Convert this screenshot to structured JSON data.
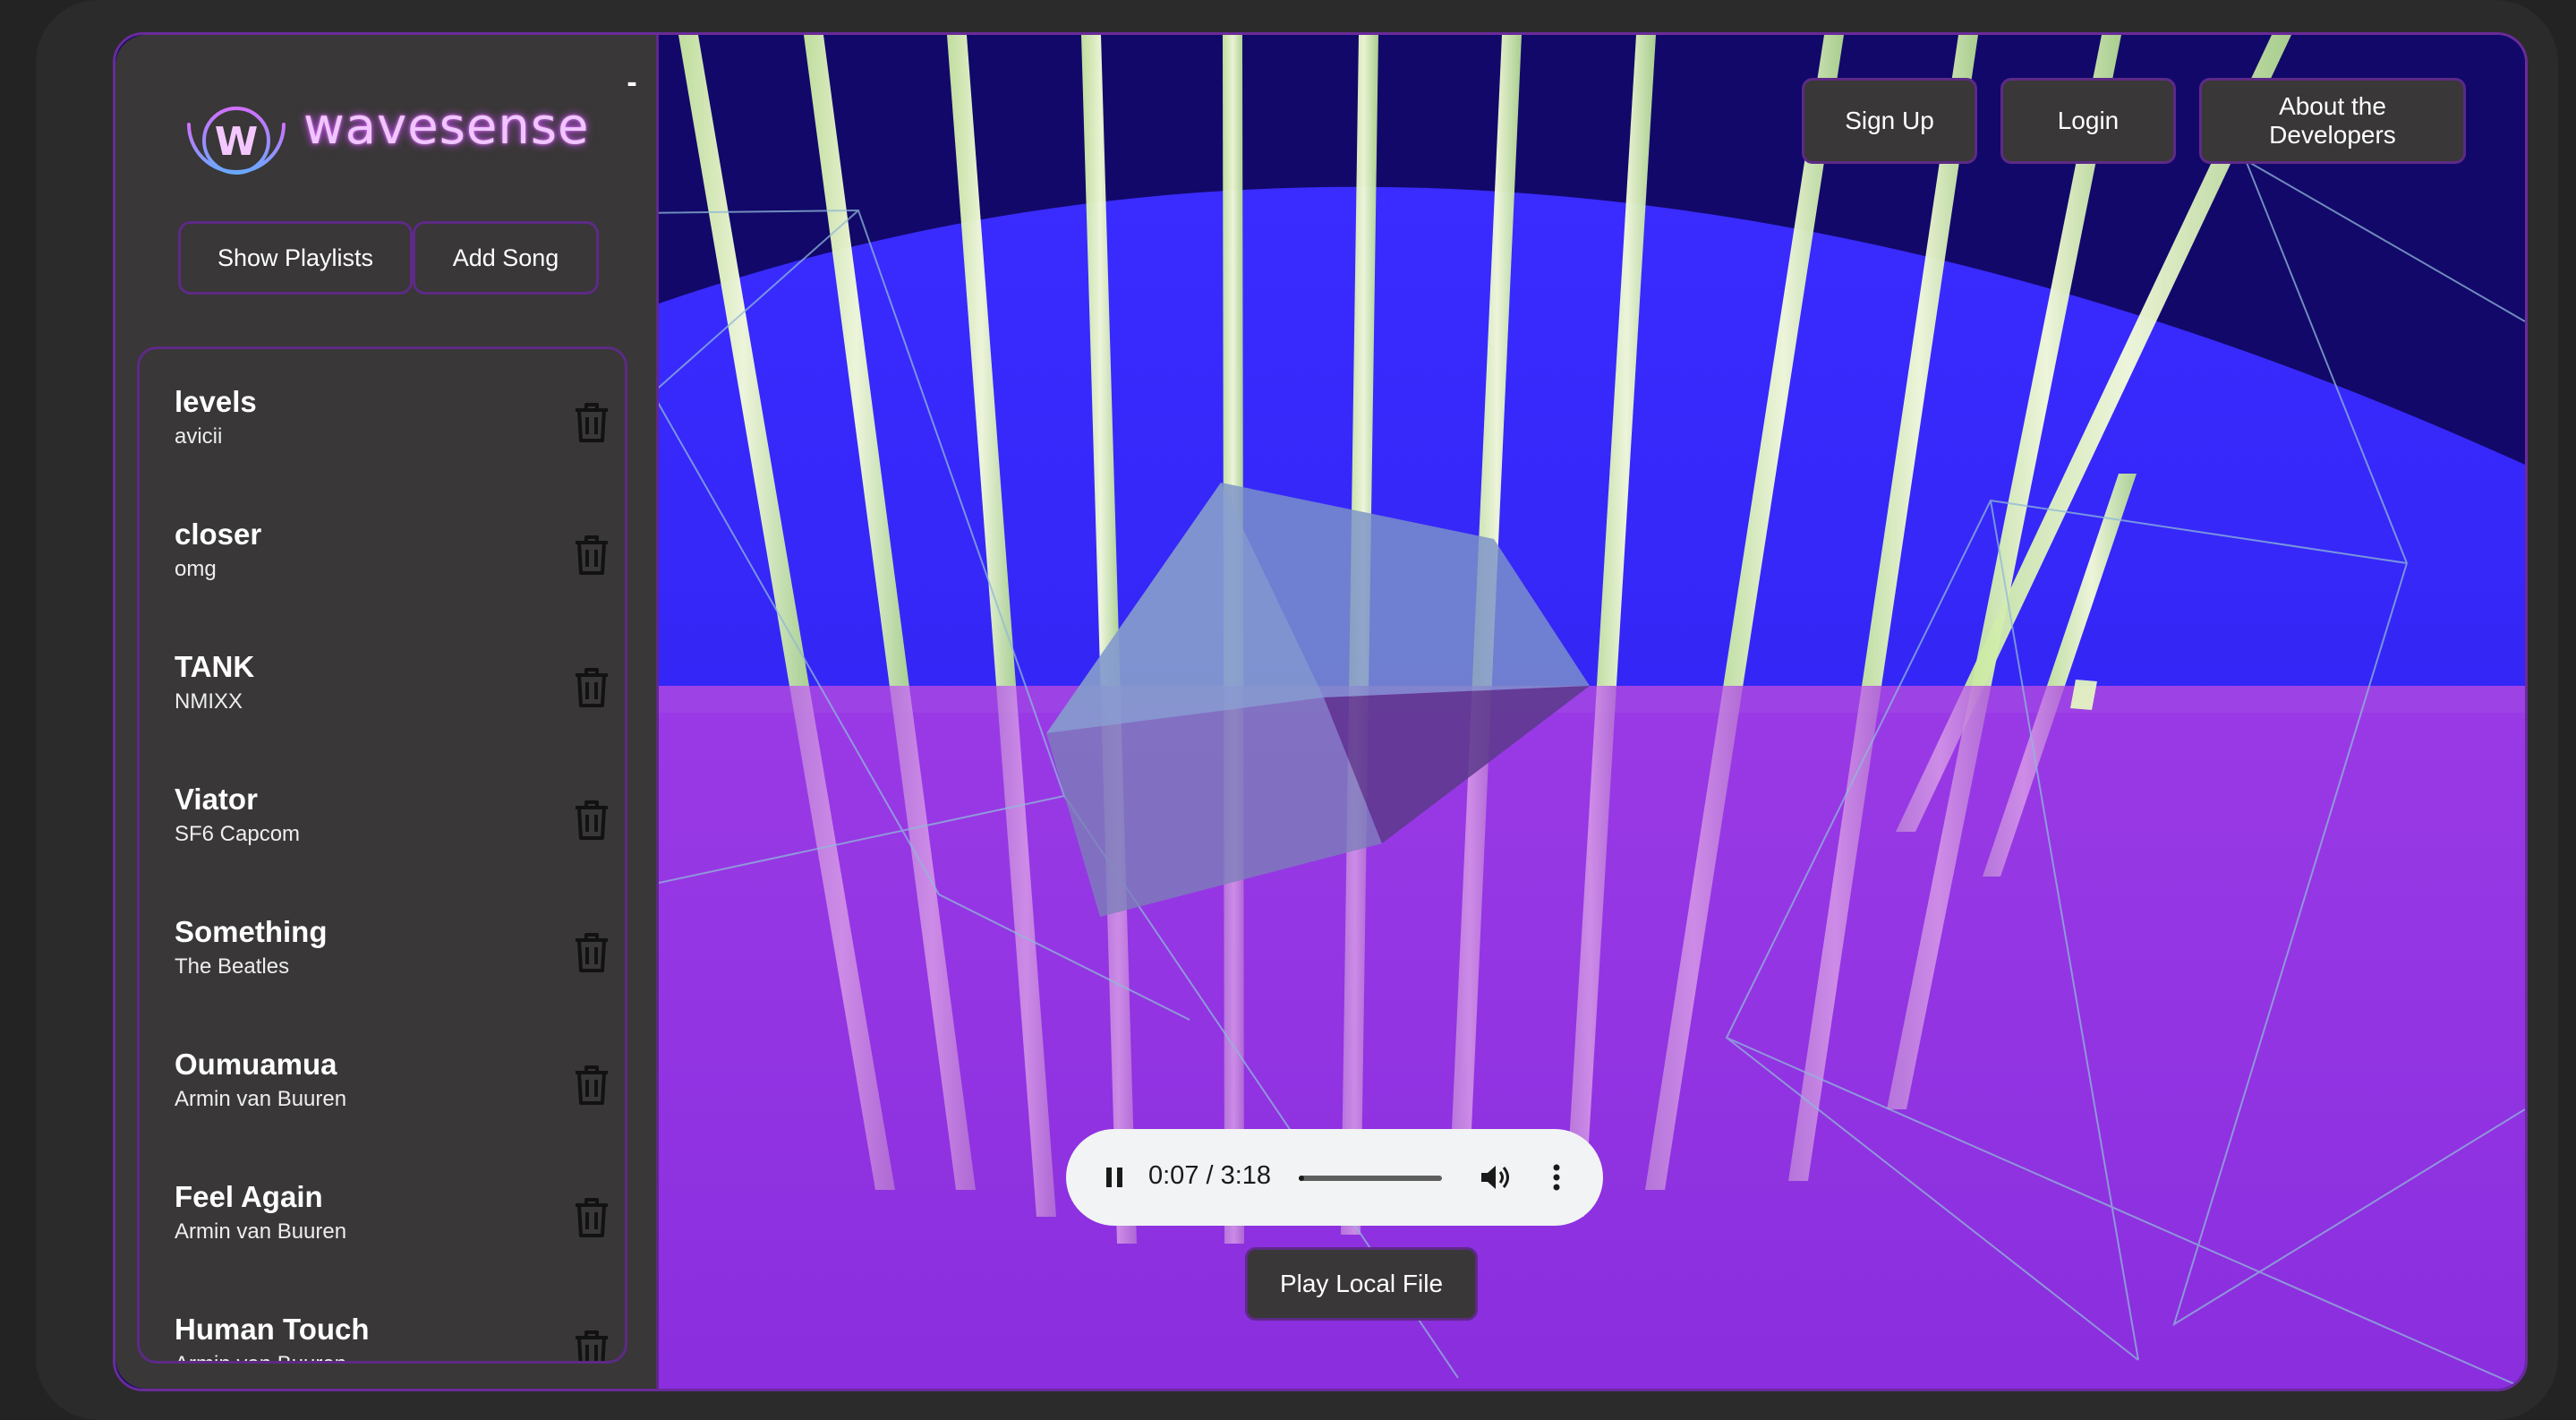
{
  "app": {
    "brand": "wavesense",
    "collapse_label": "-"
  },
  "sidebar": {
    "show_playlists_label": "Show Playlists",
    "add_song_label": "Add Song",
    "songs": [
      {
        "title": "levels",
        "artist": "avicii"
      },
      {
        "title": "closer",
        "artist": "omg"
      },
      {
        "title": "TANK",
        "artist": "NMIXX"
      },
      {
        "title": "Viator",
        "artist": "SF6 Capcom"
      },
      {
        "title": "Something",
        "artist": "The Beatles"
      },
      {
        "title": "Oumuamua",
        "artist": "Armin van Buuren"
      },
      {
        "title": "Feel Again",
        "artist": "Armin van Buuren"
      },
      {
        "title": "Human Touch",
        "artist": "Armin van Buuren"
      }
    ]
  },
  "header": {
    "signup_label": "Sign Up",
    "login_label": "Login",
    "about_label": "About the Developers"
  },
  "player": {
    "time_display": "0:07 / 3:18",
    "progress_fraction": 0.04
  },
  "play_local_label": "Play Local File",
  "colors": {
    "accent_border": "#5d2a86",
    "panel_bg": "#393737",
    "sky_blue": "#3023f0",
    "floor_purple": "#8c2fe0",
    "bar_green": "#e8ffb8"
  }
}
